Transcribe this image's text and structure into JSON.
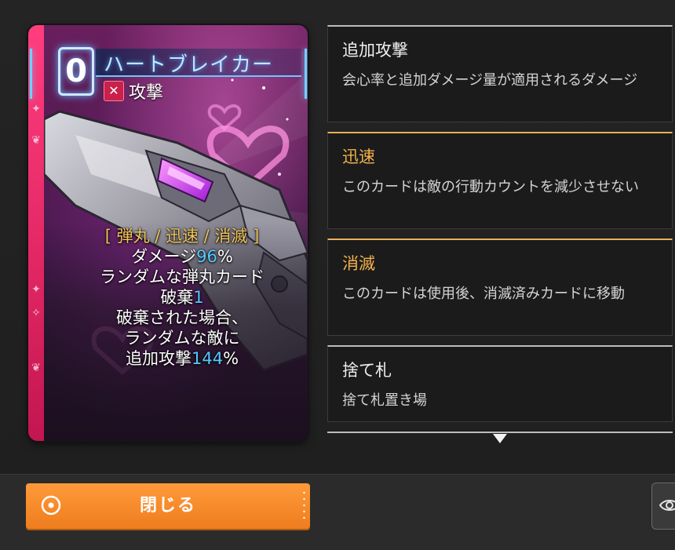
{
  "card": {
    "cost": "0",
    "name": "ハートブレイカー",
    "type_icon": "crossed-swords-icon",
    "type_label": "攻撃",
    "tags_line": "[ 弾丸 / 迅速 / 消滅 ]",
    "line_damage_prefix": "ダメージ",
    "line_damage_value": "96",
    "line_damage_suffix": "%",
    "line_random_card": "ランダムな弾丸カード",
    "line_discard_prefix": "破棄",
    "line_discard_value": "1",
    "line_if_discarded": "破棄された場合、",
    "line_random_enemy": "ランダムな敵に",
    "line_extra_prefix": "追加攻撃",
    "line_extra_value": "144",
    "line_extra_suffix": "%",
    "highlight_color": "#56c8ff",
    "frame_color": "#e02662"
  },
  "keywords": [
    {
      "title": "追加攻撃",
      "description": "会心率と追加ダメージ量が適用されるダメージ"
    },
    {
      "title": "迅速",
      "description": "このカードは敵の行動カウントを減少させない"
    },
    {
      "title": "消滅",
      "description": "このカードは使用後、消滅済みカードに移動"
    },
    {
      "title": "捨て札",
      "description": "捨て札置き場"
    }
  ],
  "footer": {
    "close_label": "閉じる",
    "close_icon": "target-circle-icon",
    "view_icon": "eye-icon",
    "button_color": "#f08a2a"
  }
}
